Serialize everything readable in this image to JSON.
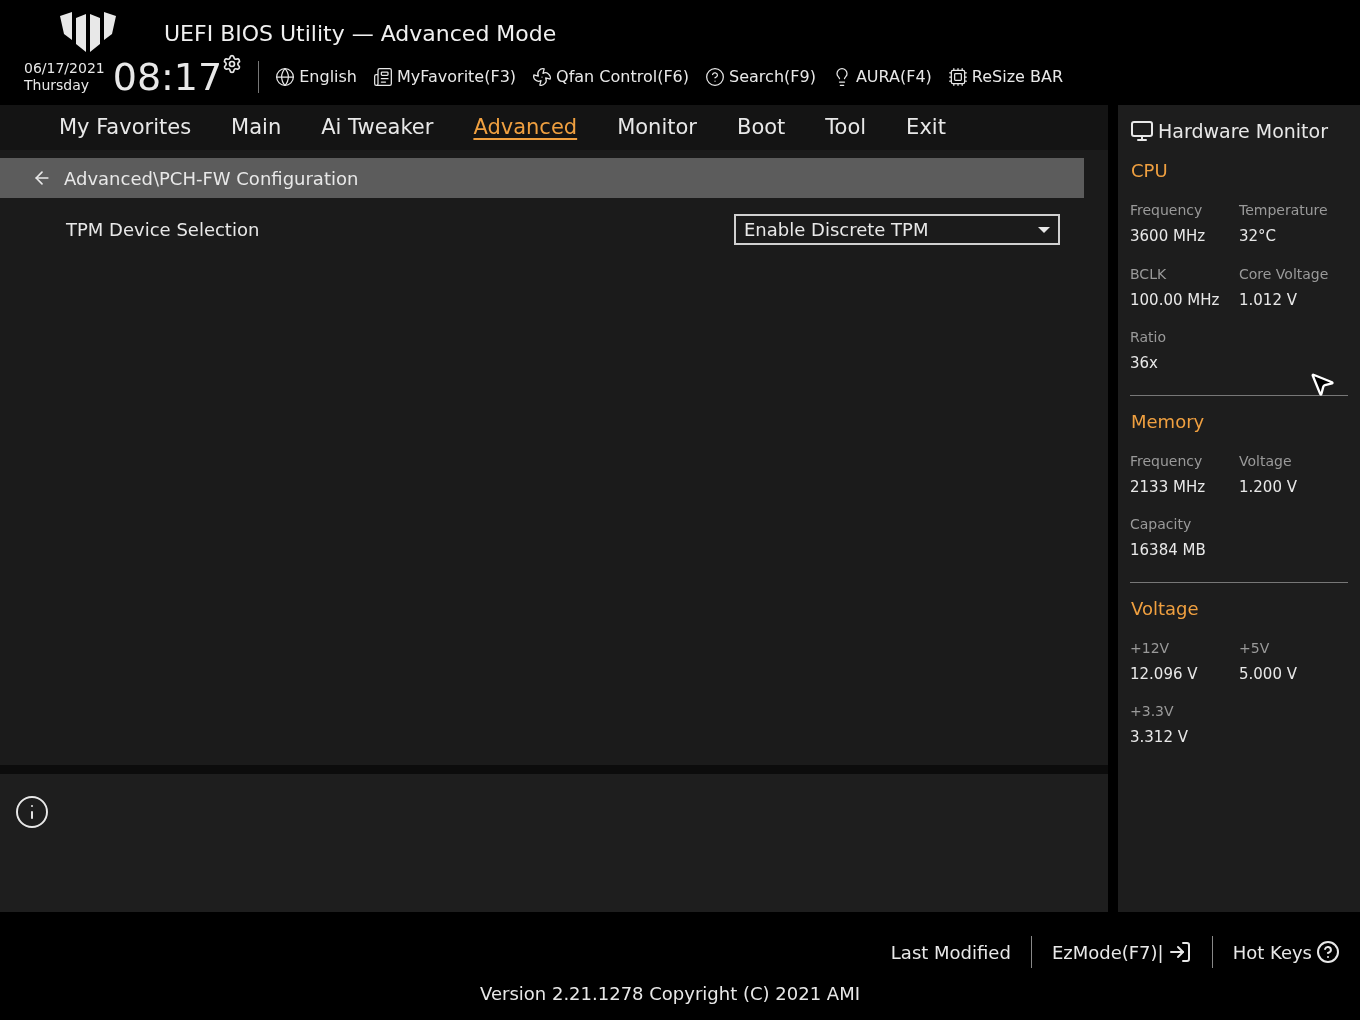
{
  "header": {
    "title": "UEFI BIOS Utility — Advanced Mode",
    "date": "06/17/2021",
    "day": "Thursday",
    "time": "08:17",
    "tools": [
      {
        "kind": "language",
        "label": "English"
      },
      {
        "kind": "favorite",
        "label": "MyFavorite(F3)"
      },
      {
        "kind": "fan",
        "label": "Qfan Control(F6)"
      },
      {
        "kind": "search",
        "label": "Search(F9)"
      },
      {
        "kind": "aura",
        "label": "AURA(F4)"
      },
      {
        "kind": "resize",
        "label": "ReSize BAR"
      }
    ]
  },
  "tabs": [
    {
      "label": "My Favorites",
      "selected": false
    },
    {
      "label": "Main",
      "selected": false
    },
    {
      "label": "Ai Tweaker",
      "selected": false
    },
    {
      "label": "Advanced",
      "selected": true
    },
    {
      "label": "Monitor",
      "selected": false
    },
    {
      "label": "Boot",
      "selected": false
    },
    {
      "label": "Tool",
      "selected": false
    },
    {
      "label": "Exit",
      "selected": false
    }
  ],
  "breadcrumb": "Advanced\\PCH-FW Configuration",
  "settings": [
    {
      "label": "TPM Device Selection",
      "value": "Enable Discrete TPM"
    }
  ],
  "hardware_monitor": {
    "title": "Hardware Monitor",
    "sections": [
      {
        "title": "CPU",
        "items": [
          {
            "label": "Frequency",
            "value": "3600 MHz"
          },
          {
            "label": "Temperature",
            "value": "32°C"
          },
          {
            "label": "BCLK",
            "value": "100.00 MHz"
          },
          {
            "label": "Core Voltage",
            "value": "1.012 V"
          },
          {
            "label": "Ratio",
            "value": "36x"
          }
        ]
      },
      {
        "title": "Memory",
        "items": [
          {
            "label": "Frequency",
            "value": "2133 MHz"
          },
          {
            "label": "Voltage",
            "value": "1.200 V"
          },
          {
            "label": "Capacity",
            "value": "16384 MB"
          }
        ]
      },
      {
        "title": "Voltage",
        "items": [
          {
            "label": "+12V",
            "value": "12.096 V"
          },
          {
            "label": "+5V",
            "value": "5.000 V"
          },
          {
            "label": "+3.3V",
            "value": "3.312 V"
          }
        ]
      }
    ]
  },
  "footer": {
    "actions": [
      {
        "kind": "last",
        "label": "Last Modified"
      },
      {
        "kind": "ezmode",
        "label": "EzMode(F7)|"
      },
      {
        "kind": "hotkeys",
        "label": "Hot Keys"
      }
    ],
    "version": "Version 2.21.1278 Copyright (C) 2021 AMI"
  }
}
